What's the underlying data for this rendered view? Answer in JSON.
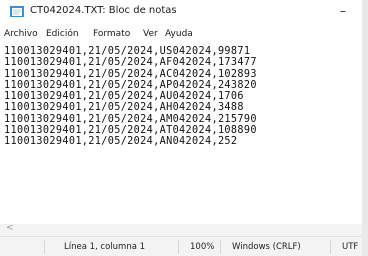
{
  "window": {
    "title": "CT042024.TXT: Bloc de notas",
    "minimize_glyph": "–"
  },
  "menu": [
    "Archivo",
    "Edición",
    "Formato",
    "Ver",
    "Ayuda"
  ],
  "editor": {
    "lines": [
      "110013029401,21/05/2024,US042024,99871",
      "110013029401,21/05/2024,AF042024,173477",
      "110013029401,21/05/2024,AC042024,102893",
      "110013029401,21/05/2024,AP042024,243820",
      "110013029401,21/05/2024,AU042024,1706",
      "110013029401,21/05/2024,AH042024,3488",
      "110013029401,21/05/2024,AM042024,215790",
      "110013029401,21/05/2024,AT042024,108890",
      "110013029401,21/05/2024,AN042024,252"
    ]
  },
  "scrollbar": {
    "left_arrow": "<"
  },
  "status": {
    "position": "Línea 1, columna 1",
    "zoom": "100%",
    "line_ending": "Windows (CRLF)",
    "encoding": "UTF"
  },
  "colors": {
    "notepad_icon_blue": "#3b8fd9",
    "notepad_icon_paper": "#ffffff",
    "statusbar_bg": "#f3f3f3"
  }
}
